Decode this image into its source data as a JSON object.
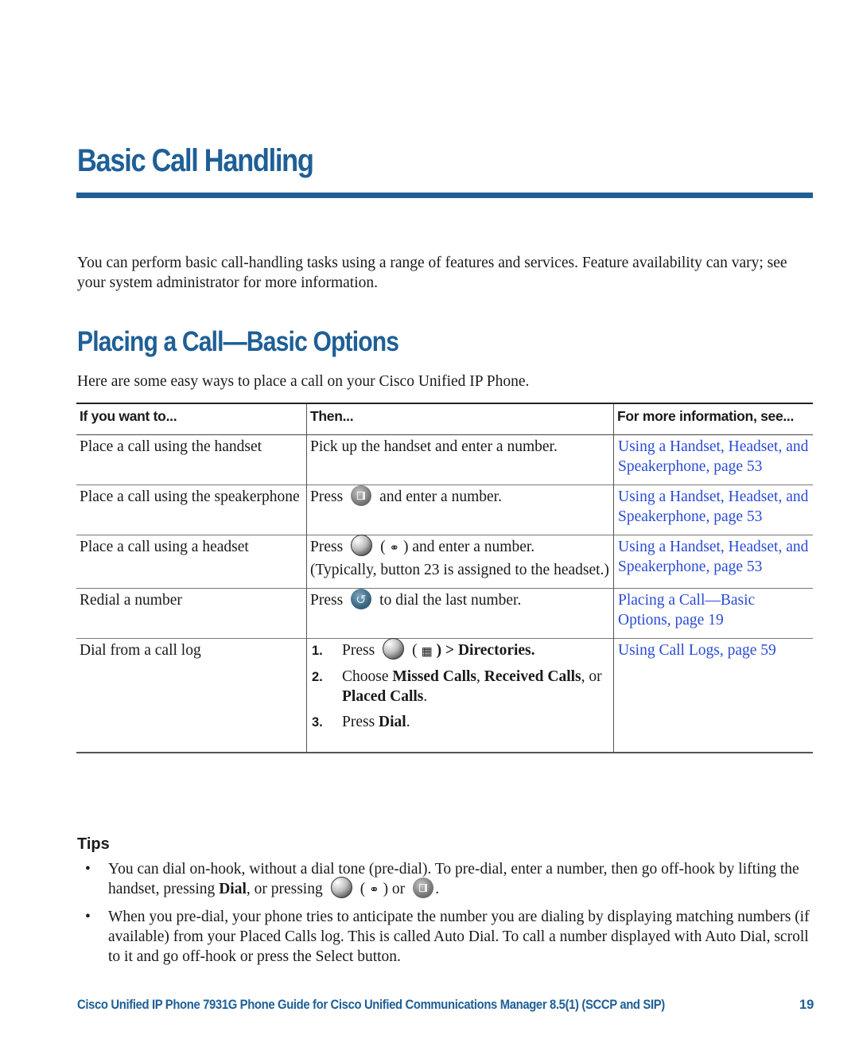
{
  "chapter": {
    "title": "Basic Call Handling"
  },
  "intro": "You can perform basic call-handling tasks using a range of features and services. Feature availability can vary; see your system administrator for more information.",
  "section": {
    "title": "Placing a Call—Basic Options",
    "lead": "Here are some easy ways to place a call on your Cisco Unified IP Phone."
  },
  "table": {
    "headers": [
      "If you want to...",
      "Then...",
      "For more information, see..."
    ],
    "rows": [
      {
        "want": "Place a call using the handset",
        "then_text": "Pick up the handset and enter a number.",
        "see": "Using a Handset, Headset, and Speakerphone, page 53"
      },
      {
        "want": "Place a call using the speakerphone",
        "then_press": "Press",
        "then_icon": "speaker-button-icon",
        "then_after": "and enter a number.",
        "see": "Using a Handset, Headset, and Speakerphone, page 53"
      },
      {
        "want": "Place a call using a headset",
        "then_press": "Press",
        "then_icon": "session-button-icon",
        "then_glyph": "headset-icon",
        "then_after": ") and enter a number.",
        "then_note": "(Typically, button 23 is assigned to the headset.)",
        "see": "Using a Handset, Headset, and Speakerphone, page 53"
      },
      {
        "want": "Redial a number",
        "then_press": "Press",
        "then_icon": "redial-button-icon",
        "then_after": "to dial the last number.",
        "see": "Placing a Call—Basic Options, page 19"
      },
      {
        "want": "Dial from a call log",
        "steps": [
          {
            "num": "1.",
            "pre": "Press",
            "icon": "session-button-icon",
            "glyph": "directories-icon",
            "post_bold": ") > Directories."
          },
          {
            "num": "2.",
            "pre": "Choose ",
            "b1": "Missed Calls",
            "m1": ", ",
            "b2": "Received Calls",
            "m2": ", or ",
            "b3": "Placed Calls",
            "m3": "."
          },
          {
            "num": "3.",
            "pre": "Press ",
            "b1": "Dial",
            "m1": "."
          }
        ],
        "see": "Using Call Logs, page 59"
      }
    ]
  },
  "tips": {
    "heading": "Tips",
    "items": [
      {
        "text_a": "You can dial on-hook, without a dial tone (pre-dial). To pre-dial, enter a number, then go off-hook by lifting the handset, pressing ",
        "bold": "Dial",
        "text_b": ", or pressing",
        "text_c": ") or",
        "text_d": "."
      },
      {
        "text": "When you pre-dial, your phone tries to anticipate the number you are dialing by displaying matching numbers (if available) from your Placed Calls log. This is called Auto Dial. To call a number displayed with Auto Dial, scroll to it and go off-hook or press the Select button."
      }
    ]
  },
  "footer": {
    "title": "Cisco Unified IP Phone 7931G Phone Guide for Cisco Unified Communications Manager 8.5(1) (SCCP and SIP)",
    "page": "19"
  },
  "colors": {
    "heading": "#1f5f96",
    "link": "#2a4bd7"
  }
}
